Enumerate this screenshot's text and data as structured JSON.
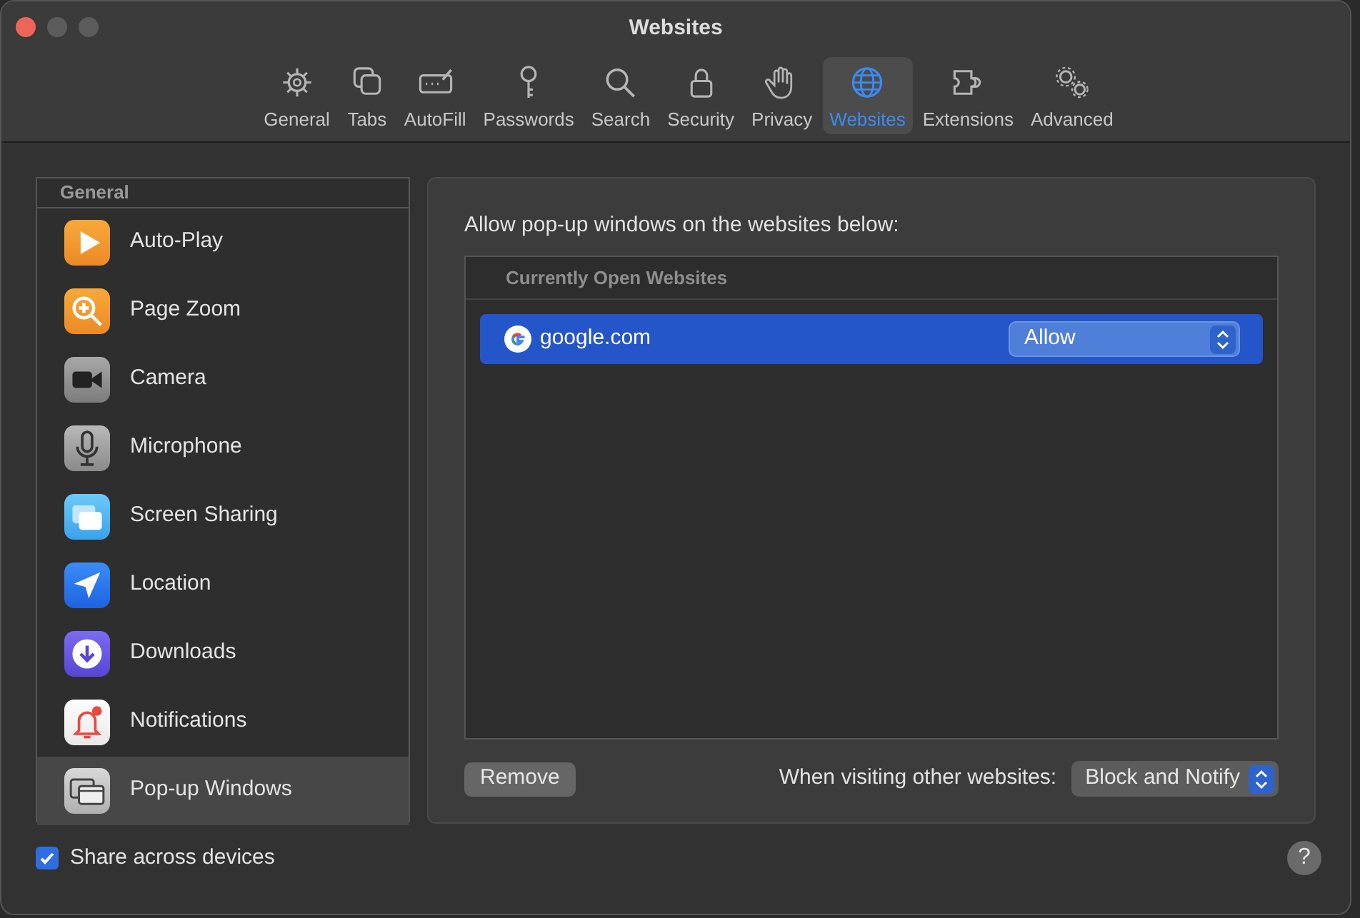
{
  "window": {
    "title": "Websites"
  },
  "tabs": [
    {
      "label": "General",
      "selected": false
    },
    {
      "label": "Tabs",
      "selected": false
    },
    {
      "label": "AutoFill",
      "selected": false
    },
    {
      "label": "Passwords",
      "selected": false
    },
    {
      "label": "Search",
      "selected": false
    },
    {
      "label": "Security",
      "selected": false
    },
    {
      "label": "Privacy",
      "selected": false
    },
    {
      "label": "Websites",
      "selected": true
    },
    {
      "label": "Extensions",
      "selected": false
    },
    {
      "label": "Advanced",
      "selected": false
    }
  ],
  "sidebar": {
    "header": "General",
    "items": [
      {
        "label": "Auto-Play",
        "selected": false
      },
      {
        "label": "Page Zoom",
        "selected": false
      },
      {
        "label": "Camera",
        "selected": false
      },
      {
        "label": "Microphone",
        "selected": false
      },
      {
        "label": "Screen Sharing",
        "selected": false
      },
      {
        "label": "Location",
        "selected": false
      },
      {
        "label": "Downloads",
        "selected": false
      },
      {
        "label": "Notifications",
        "selected": false
      },
      {
        "label": "Pop-up Windows",
        "selected": true
      }
    ]
  },
  "panel": {
    "heading": "Allow pop-up windows on the websites below:",
    "table": {
      "section": "Currently Open Websites",
      "rows": [
        {
          "site": "google.com",
          "setting": "Allow",
          "selected": true
        }
      ]
    },
    "remove_button": "Remove",
    "other_label": "When visiting other websites:",
    "other_value": "Block and Notify"
  },
  "share_checkbox": {
    "label": "Share across devices",
    "checked": true
  },
  "help_button": "?"
}
